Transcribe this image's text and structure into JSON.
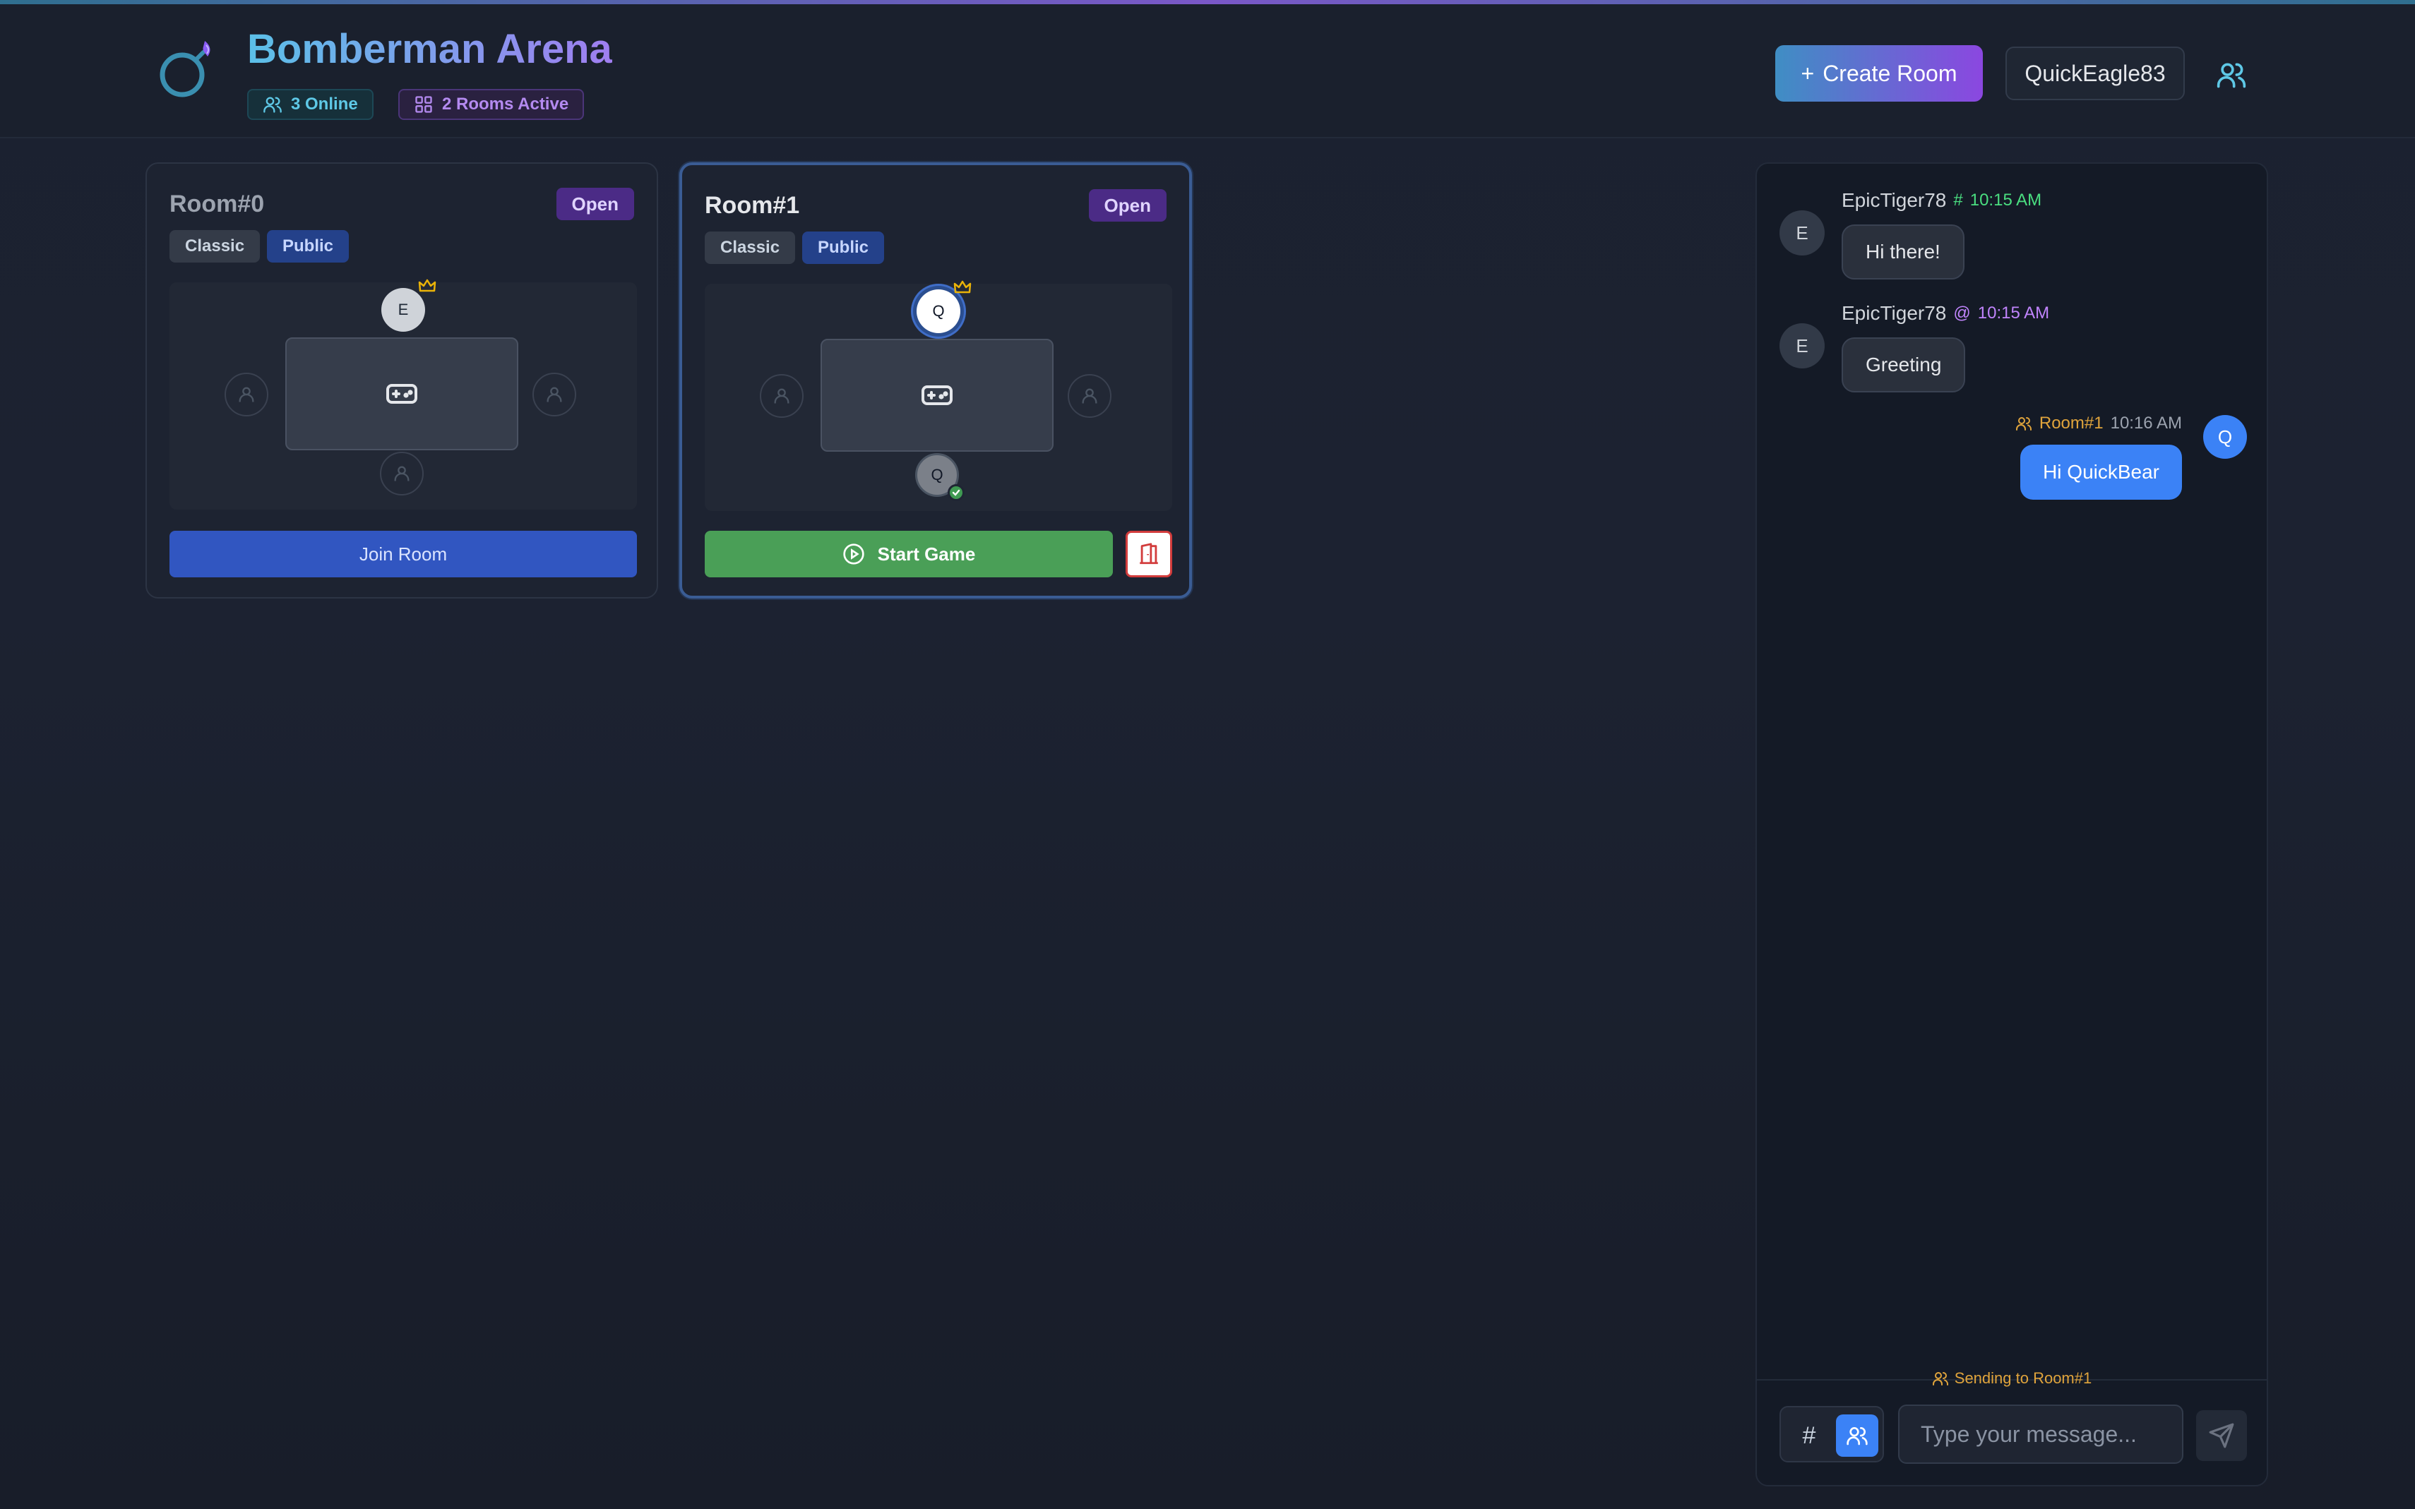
{
  "app": {
    "title": "Bomberman Arena",
    "online": "3 Online",
    "rooms_active": "2 Rooms Active"
  },
  "header": {
    "create_room": "Create Room",
    "username": "QuickEagle83"
  },
  "rooms": [
    {
      "name": "Room#0",
      "status": "Open",
      "mode": "Classic",
      "visibility": "Public",
      "seats": {
        "top": "E",
        "bottom": "",
        "left": "",
        "right": ""
      },
      "action": "Join Room"
    },
    {
      "name": "Room#1",
      "status": "Open",
      "mode": "Classic",
      "visibility": "Public",
      "seats": {
        "top": "Q",
        "bottom": "Q",
        "left": "",
        "right": ""
      },
      "action": "Start Game"
    }
  ],
  "chat": {
    "messages": [
      {
        "avatar": "E",
        "sender": "EpicTiger78",
        "channel_icon": "#",
        "time": "10:15 AM",
        "text": "Hi there!"
      },
      {
        "avatar": "E",
        "sender": "EpicTiger78",
        "channel_icon": "@",
        "time": "10:15 AM",
        "text": "Greeting"
      },
      {
        "avatar": "Q",
        "room": "Room#1",
        "time": "10:16 AM",
        "text": "Hi QuickBear"
      }
    ],
    "sending_to": "Sending to Room#1",
    "mode_global": "#",
    "input_placeholder": "Type your message..."
  },
  "colors": {
    "accent_blue": "#3b82f6",
    "accent_purple": "#8b47e0",
    "start_green": "#4a9f57",
    "leave_red": "#d23c3c",
    "room_msg_orange": "#e0a43c"
  }
}
